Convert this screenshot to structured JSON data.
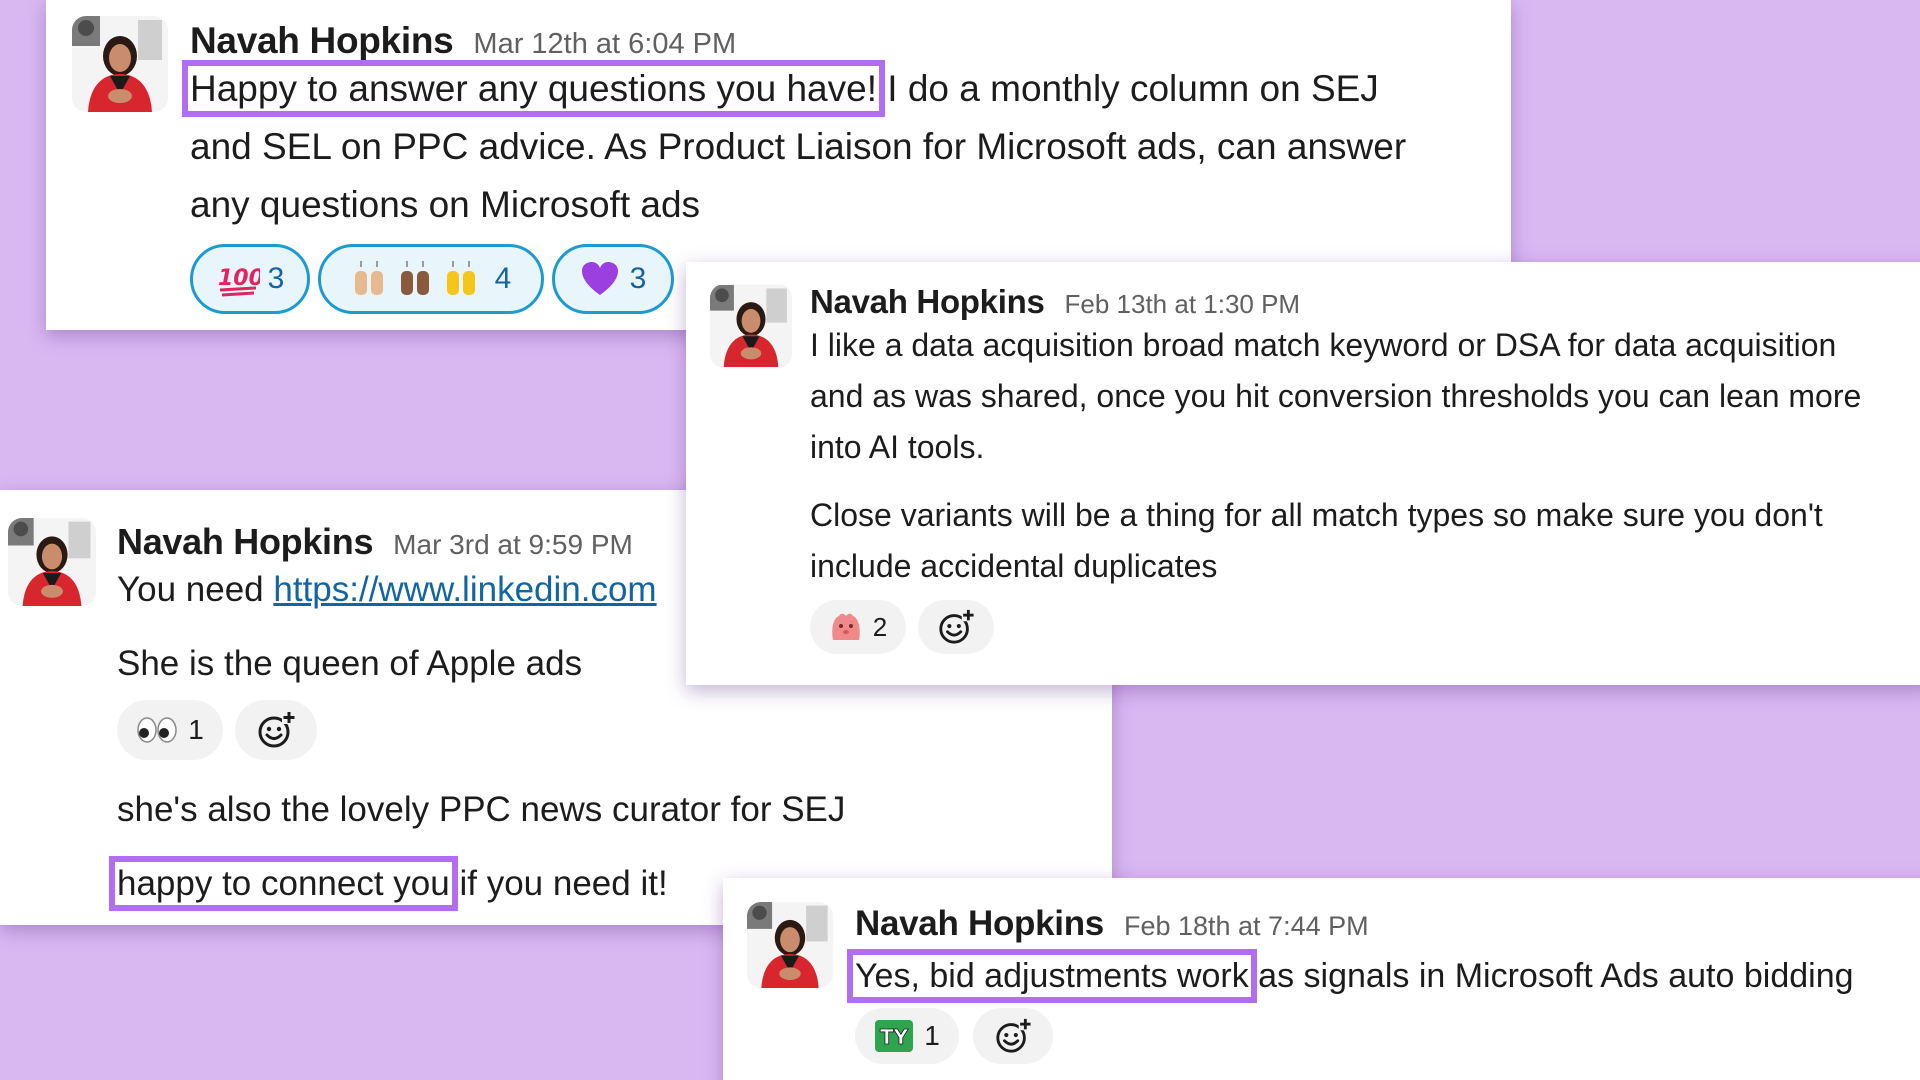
{
  "messages": {
    "m1": {
      "author": "Navah Hopkins",
      "timestamp": "Mar 12th at 6:04 PM",
      "line1_highlight": "Happy to answer any questions you have!",
      "line1_rest": " I do a monthly column on SEJ",
      "line2": "and SEL on PPC advice. As Product Liaison for Microsoft ads, can answer",
      "line3": "any questions on Microsoft ads",
      "reactions": [
        {
          "icon": "hundred-points-icon",
          "count": "3"
        },
        {
          "icon": "raised-hands-icon",
          "count": "4"
        },
        {
          "icon": "purple-heart-icon",
          "count": "3"
        }
      ]
    },
    "m2": {
      "author": "Navah Hopkins",
      "timestamp": "Feb 13th at 1:30 PM",
      "p1_line1": "I like a data acquisition broad match keyword or DSA for data acquisition",
      "p1_line2": "and as was shared, once you hit conversion thresholds you can lean more",
      "p1_line3": "into AI tools.",
      "p2_line1": "Close variants will be a thing for all match types so make sure you don't",
      "p2_line2": "include accidental duplicates",
      "reactions": [
        {
          "icon": "pink-blob-icon",
          "count": "2"
        }
      ]
    },
    "m3": {
      "author": "Navah Hopkins",
      "timestamp": "Mar 3rd at 9:59 PM",
      "line1_prefix": "You need ",
      "line1_link": "https://www.linkedin.com",
      "line2": "She is the queen of Apple ads",
      "reactions": [
        {
          "icon": "eyes-icon",
          "count": "1"
        }
      ],
      "line3": "she's also the lovely PPC news curator for SEJ",
      "line4_highlight": "happy to connect you",
      "line4_rest": " if you need it!"
    },
    "m4": {
      "author": "Navah Hopkins",
      "timestamp": "Feb 18th at 7:44 PM",
      "line1_highlight": "Yes, bid adjustments work",
      "line1_rest": " as signals in Microsoft Ads auto bidding",
      "reactions": [
        {
          "icon": "ty-icon",
          "count": "1"
        }
      ]
    }
  },
  "colors": {
    "background": "#d9b8f2",
    "highlight": "#b16df4",
    "link": "#1264a3",
    "reaction_active_border": "#1d9bd1"
  }
}
